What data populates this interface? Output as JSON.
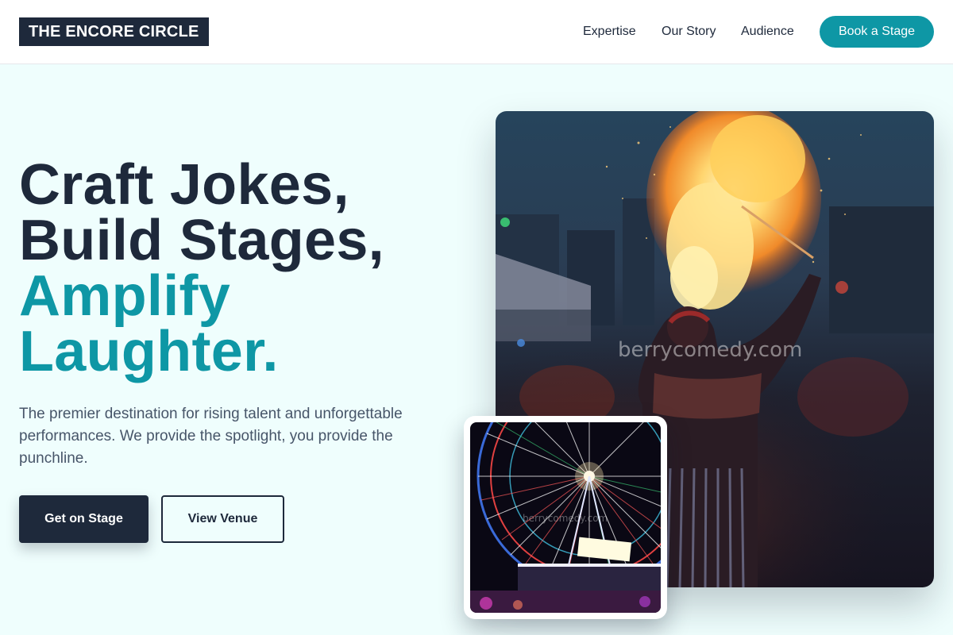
{
  "brand": {
    "name": "THE ENCORE CIRCLE"
  },
  "nav": {
    "items": [
      "Expertise",
      "Our Story",
      "Audience"
    ],
    "cta": "Book a Stage"
  },
  "hero": {
    "headline_lines": [
      "Craft Jokes,",
      "Build Stages,",
      "Amplify",
      "Laughter."
    ],
    "lead": "The premier destination for rising talent and unforgettable performances. We provide the spotlight, you provide the punchline.",
    "primary_cta": "Get on Stage",
    "secondary_cta": "View Venue"
  },
  "media": {
    "main_watermark": "berrycomedy.com",
    "small_watermark": "berrycomedy.com"
  },
  "colors": {
    "accent": "#0e97a5",
    "dark": "#1e293b",
    "background": "#effefd",
    "text_muted": "#475569"
  }
}
